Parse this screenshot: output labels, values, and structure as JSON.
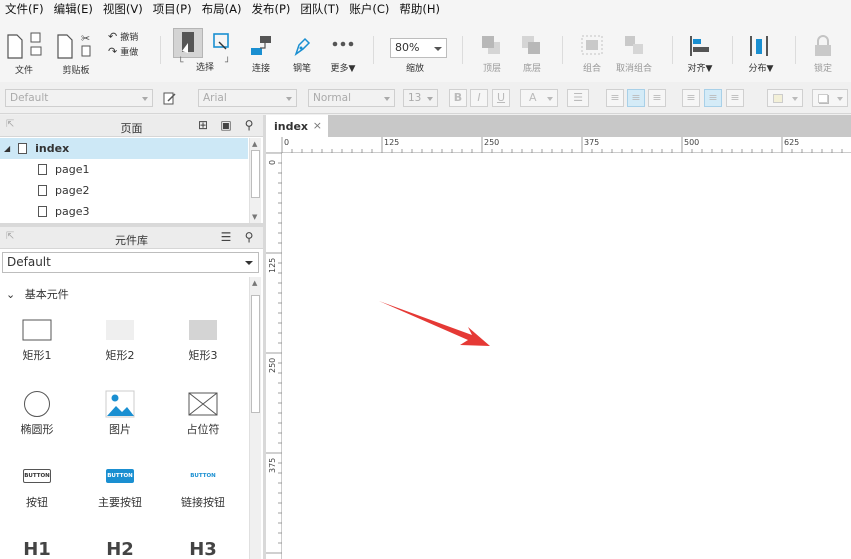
{
  "menu": [
    "文件(F)",
    "编辑(E)",
    "视图(V)",
    "项目(P)",
    "布局(A)",
    "发布(P)",
    "团队(T)",
    "账户(C)",
    "帮助(H)"
  ],
  "toolbar": {
    "file": "文件",
    "clipboard": "剪贴板",
    "undo": "撤销",
    "redo": "重做",
    "select": "选择",
    "connect": "连接",
    "pen": "钢笔",
    "more": "更多▼",
    "zoom_value": "80%",
    "zoom_label": "缩放",
    "top": "顶层",
    "bottom": "底层",
    "group": "组合",
    "ungroup": "取消组合",
    "align": "对齐▼",
    "distribute": "分布▼",
    "lock": "锁定"
  },
  "format": {
    "style": "Default",
    "font": "Arial",
    "weight": "Normal",
    "size": "13",
    "bold": "B",
    "italic": "I",
    "underline": "U",
    "text_color": "A"
  },
  "pages_panel": {
    "title": "页面",
    "items": [
      {
        "label": "index",
        "selected": true
      },
      {
        "label": "page1"
      },
      {
        "label": "page2"
      },
      {
        "label": "page3"
      }
    ]
  },
  "library_panel": {
    "title": "元件库",
    "selected_library": "Default",
    "group": "基本元件",
    "widgets": [
      {
        "label": "矩形1",
        "icon": "rectangle-icon"
      },
      {
        "label": "矩形2",
        "icon": "rectangle-light-icon"
      },
      {
        "label": "矩形3",
        "icon": "rectangle-gray-icon"
      },
      {
        "label": "椭圆形",
        "icon": "ellipse-icon"
      },
      {
        "label": "图片",
        "icon": "image-icon"
      },
      {
        "label": "占位符",
        "icon": "placeholder-icon"
      },
      {
        "label": "按钮",
        "icon": "button-icon",
        "preview": "BUTTON"
      },
      {
        "label": "主要按钮",
        "icon": "primary-button-icon",
        "preview": "BUTTON"
      },
      {
        "label": "链接按钮",
        "icon": "link-button-icon",
        "preview": "BUTTON"
      },
      {
        "preview": "H1"
      },
      {
        "preview": "H2"
      },
      {
        "preview": "H3"
      }
    ]
  },
  "canvas": {
    "tab": "index",
    "close": "×",
    "ruler_h": [
      "0",
      "125",
      "250",
      "375",
      "500",
      "625"
    ],
    "ruler_v": [
      "0",
      "125",
      "250",
      "375"
    ]
  },
  "colors": {
    "accent": "#1a8fd1",
    "selection": "#cde8f6",
    "arrow": "#e53935"
  }
}
